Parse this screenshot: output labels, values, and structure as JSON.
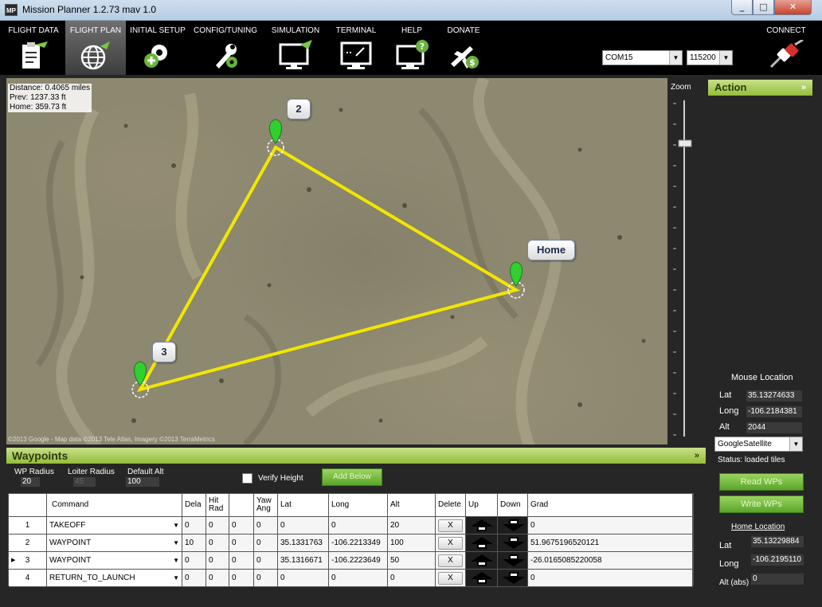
{
  "window": {
    "title": "Mission Planner 1.2.73 mav 1.0",
    "app_icon_text": "MP"
  },
  "menu": {
    "items": [
      {
        "label": "FLIGHT DATA",
        "icon": "clipboard-plane-icon"
      },
      {
        "label": "FLIGHT PLAN",
        "icon": "globe-plane-icon",
        "active": true
      },
      {
        "label": "INITIAL SETUP",
        "icon": "gear-plus-icon"
      },
      {
        "label": "CONFIG/TUNING",
        "icon": "wrench-gear-icon"
      },
      {
        "label": "SIMULATION",
        "icon": "monitor-plane-icon"
      },
      {
        "label": "TERMINAL",
        "icon": "monitor-terminal-icon"
      },
      {
        "label": "HELP",
        "icon": "monitor-help-icon"
      },
      {
        "label": "DONATE",
        "icon": "plane-dollar-icon"
      }
    ],
    "port": "COM15",
    "baud": "115200",
    "connect_label": "CONNECT"
  },
  "map": {
    "distance": "Distance: 0.4065 miles",
    "prev": "Prev: 1237.33 ft",
    "home": "Home: 359.73 ft",
    "markers": [
      "2",
      "Home",
      "3"
    ],
    "copyright": "©2013 Google - Map data ©2013 Tele Atlas, Imagery ©2013 TerraMetrics",
    "route_color": "#f2e600",
    "marker_color": "#2fd02f",
    "zoom_label": "Zoom"
  },
  "action": {
    "title": "Action",
    "mouse_location_title": "Mouse Location",
    "lat_label": "Lat",
    "lat_value": "35.13274633",
    "long_label": "Long",
    "long_value": "-106.2184381",
    "alt_label": "Alt",
    "alt_value": "2044",
    "map_type": "GoogleSatellite",
    "status": "Status: loaded tiles",
    "read_wps": "Read WPs",
    "write_wps": "Write WPs",
    "home_location_title": "Home Location",
    "home_lat_label": "Lat",
    "home_lat_value": "35.13229884",
    "home_long_label": "Long",
    "home_long_value": "-106.2195110",
    "home_alt_label": "Alt (abs)",
    "home_alt_value": "0"
  },
  "waypoints": {
    "title": "Waypoints",
    "wp_radius_label": "WP Radius",
    "wp_radius": "20",
    "loiter_radius_label": "Loiter Radius",
    "loiter_radius": "45",
    "default_alt_label": "Default Alt",
    "default_alt": "100",
    "verify_height": "Verify Height",
    "add_below": "Add Below",
    "columns": [
      "Command",
      "Dela",
      "Hit Rad",
      "",
      "Yaw Ang",
      "Lat",
      "Long",
      "Alt",
      "Delete",
      "Up",
      "Down",
      "Grad"
    ],
    "rows": [
      {
        "num": "1",
        "command": "TAKEOFF",
        "p1": "0",
        "p2": "0",
        "p3": "0",
        "p4": "0",
        "lat": "0",
        "long": "0",
        "alt": "20",
        "delete": "X",
        "grad": "0"
      },
      {
        "num": "2",
        "command": "WAYPOINT",
        "p1": "10",
        "p2": "0",
        "p3": "0",
        "p4": "0",
        "lat": "35.1331763",
        "long": "-106.2213349",
        "alt": "100",
        "delete": "X",
        "grad": "51.9675196520121"
      },
      {
        "num": "3",
        "command": "WAYPOINT",
        "p1": "0",
        "p2": "0",
        "p3": "0",
        "p4": "0",
        "lat": "35.1316671",
        "long": "-106.2223649",
        "alt": "50",
        "delete": "X",
        "grad": "-26.0165085220058"
      },
      {
        "num": "4",
        "command": "RETURN_TO_LAUNCH",
        "p1": "0",
        "p2": "0",
        "p3": "0",
        "p4": "0",
        "lat": "0",
        "long": "0",
        "alt": "0",
        "delete": "X",
        "grad": "0"
      }
    ]
  }
}
